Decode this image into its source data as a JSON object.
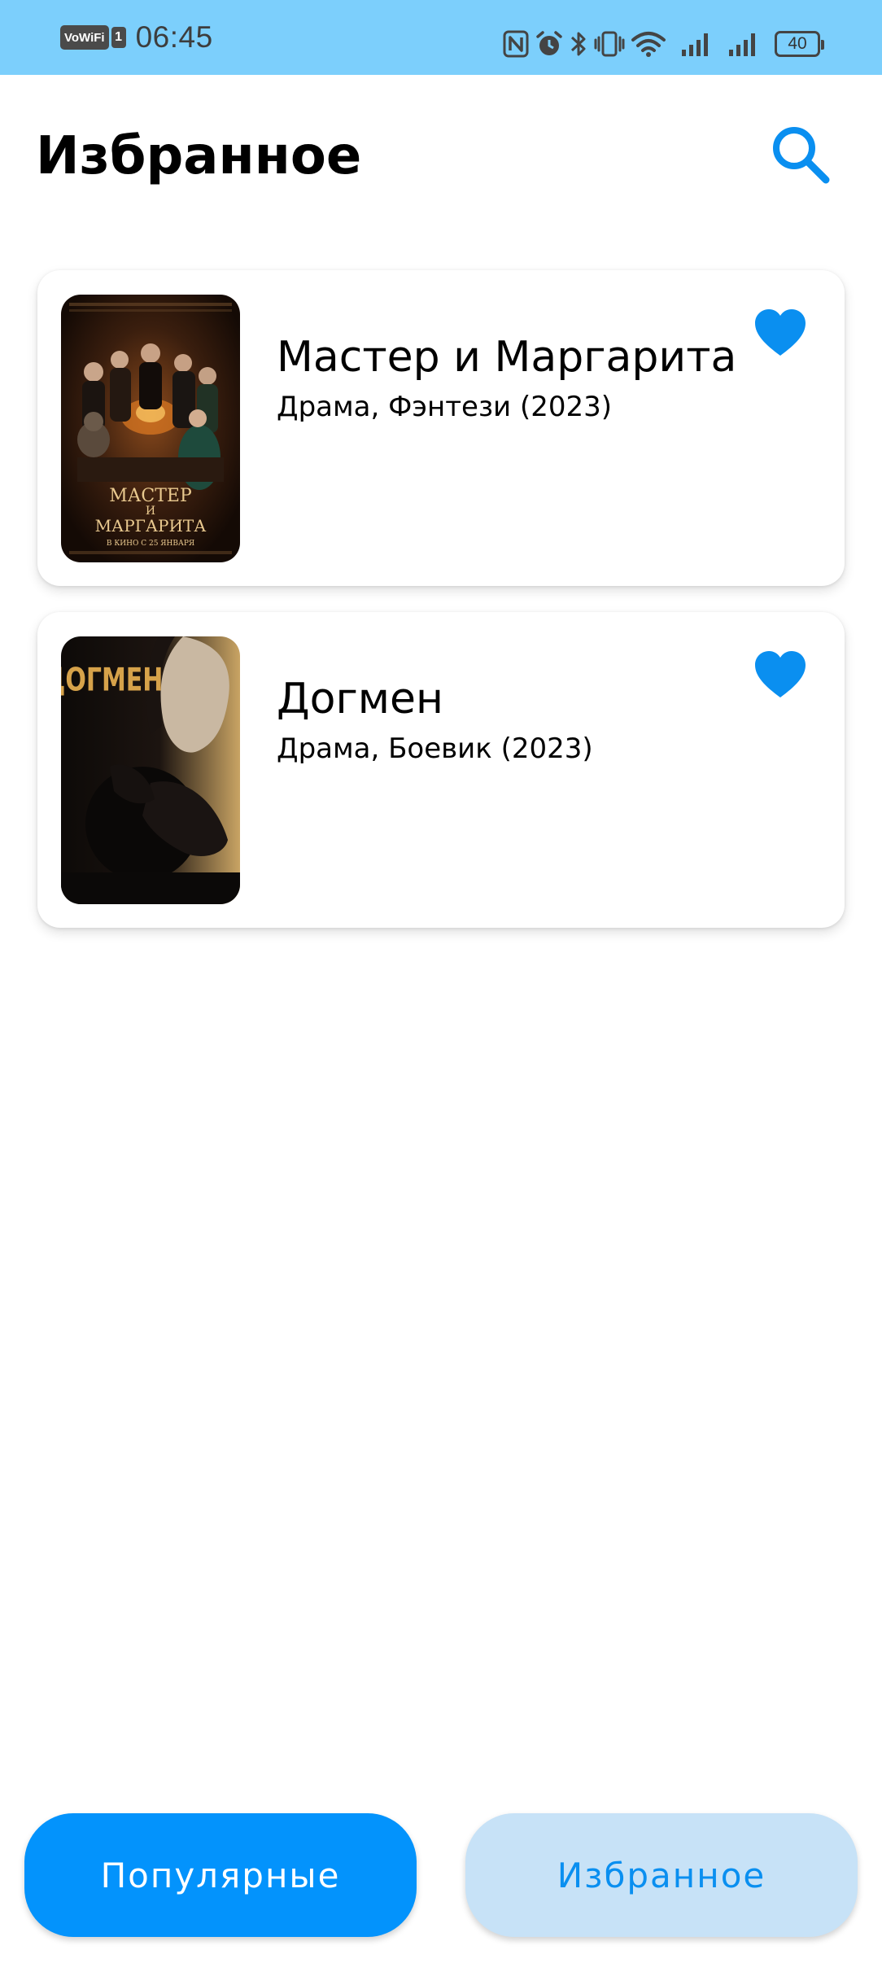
{
  "status_bar": {
    "network_badge": "VoWiFi",
    "sim_slot": "1",
    "time": "06:45",
    "battery_level": "40",
    "icons": [
      "nfc-icon",
      "alarm-icon",
      "bluetooth-icon",
      "vibrate-icon",
      "wifi-icon",
      "signal-1-icon",
      "signal-2-icon",
      "battery-icon"
    ]
  },
  "header": {
    "title": "Избранное",
    "search_icon": "search-icon"
  },
  "movies": [
    {
      "title": "Мастер и Маргарита",
      "meta": "Драма, Фэнтези (2023)",
      "favorite": true,
      "poster": {
        "title_line1": "МАСТЕР",
        "title_line2": "И",
        "title_line3": "МАРГАРИТА",
        "tagline": "В КИНО С 25 ЯНВАРЯ"
      }
    },
    {
      "title": "Догмен",
      "meta": "Драма, Боевик (2023)",
      "favorite": true,
      "poster": {
        "title": "ДОГМЕН"
      }
    }
  ],
  "bottom_nav": {
    "popular_label": "Популярные",
    "favorites_label": "Избранное",
    "active": "favorites"
  },
  "colors": {
    "status_bar": "#7ccffc",
    "accent": "#0393fc",
    "heart": "#0a8ff0",
    "inactive_tab_bg": "#c7e2f7",
    "inactive_tab_text": "#0a8ff0"
  }
}
